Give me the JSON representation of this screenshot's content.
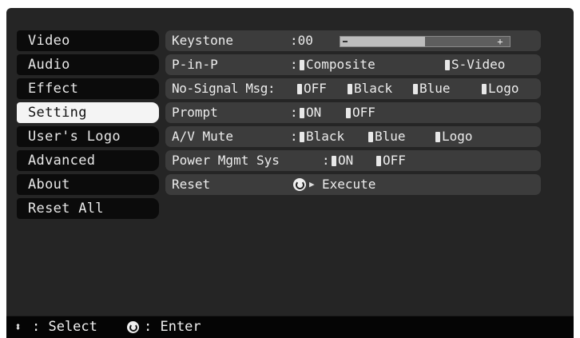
{
  "menu": {
    "items": [
      {
        "label": "Video"
      },
      {
        "label": "Audio"
      },
      {
        "label": "Effect"
      },
      {
        "label": "Setting"
      },
      {
        "label": "User's Logo"
      },
      {
        "label": "Advanced"
      },
      {
        "label": "About"
      },
      {
        "label": "Reset All"
      }
    ],
    "active": "Setting"
  },
  "settings": {
    "keystone": {
      "label": "Keystone",
      "value": ":00",
      "slider_level": 0.5
    },
    "pinp": {
      "label": "P-in-P",
      "options": [
        "Composite",
        "S-Video"
      ],
      "selected": "Composite"
    },
    "no_signal": {
      "label": "No-Signal Msg:",
      "options": [
        "OFF",
        "Black",
        "Blue",
        "Logo"
      ],
      "selected": "OFF"
    },
    "prompt": {
      "label": "Prompt",
      "options": [
        "ON",
        "OFF"
      ],
      "selected": "ON"
    },
    "av_mute": {
      "label": "A/V Mute",
      "options": [
        "Black",
        "Blue",
        "Logo"
      ],
      "selected": "Black"
    },
    "power_mgmt": {
      "label": "Power Mgmt Sys",
      "options": [
        "ON",
        "OFF"
      ],
      "selected": "ON"
    },
    "reset": {
      "label": "Reset",
      "action": "Execute"
    }
  },
  "status_bar": {
    "select_text": ": Select",
    "enter_text": ": Enter"
  },
  "colors": {
    "screen_bg": "#252525",
    "menu_item_bg": "#0b0b0b",
    "menu_active_bg": "#f4f4f4",
    "row_bg": "#3c3c3c",
    "status_bg": "#050505"
  }
}
